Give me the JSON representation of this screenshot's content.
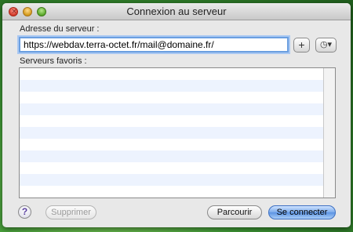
{
  "window": {
    "title": "Connexion au serveur"
  },
  "server_address": {
    "label": "Adresse du serveur :",
    "value": "https://webdav.terra-octet.fr/mail@domaine.fr/",
    "add_button_label": "+",
    "recent_button_label": "◷▾"
  },
  "favorites": {
    "label": "Serveurs favoris :",
    "rows": [
      "",
      "",
      "",
      "",
      "",
      "",
      "",
      "",
      "",
      "",
      ""
    ]
  },
  "footer": {
    "help_label": "?",
    "delete_label": "Supprimer",
    "browse_label": "Parcourir",
    "connect_label": "Se connecter"
  },
  "colors": {
    "row_alt": "#edf3fe",
    "focus_ring": "#6b9fe0",
    "default_button": "#5b93e3"
  }
}
